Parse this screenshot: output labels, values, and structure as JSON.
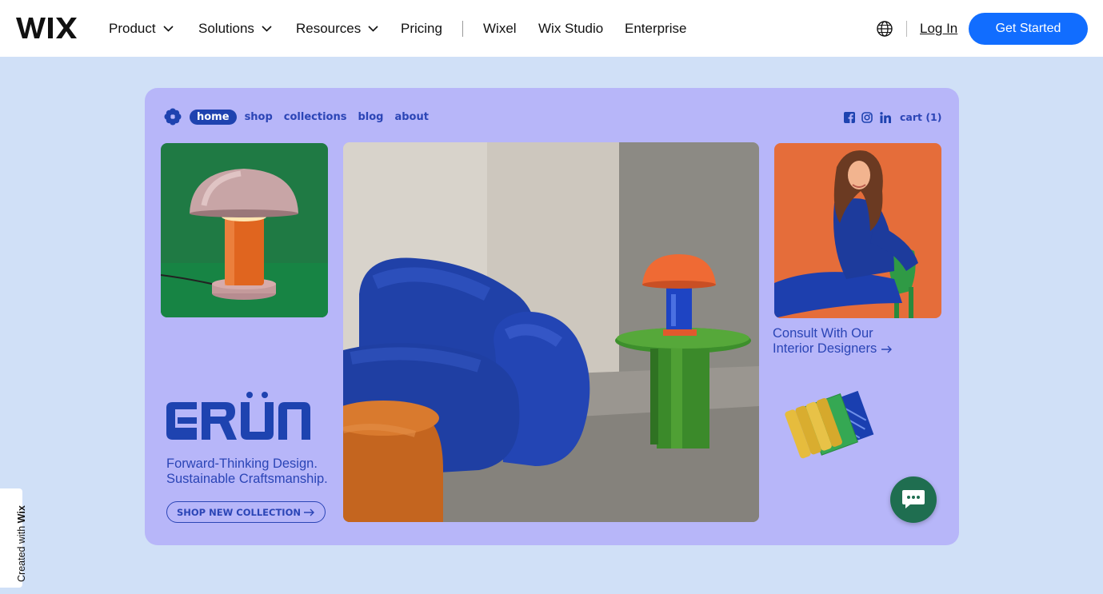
{
  "topnav": {
    "logo_text": "WIX",
    "items": [
      {
        "label": "Product",
        "dropdown": true
      },
      {
        "label": "Solutions",
        "dropdown": true
      },
      {
        "label": "Resources",
        "dropdown": true
      },
      {
        "label": "Pricing",
        "dropdown": false
      },
      {
        "label": "Wixel",
        "dropdown": false
      },
      {
        "label": "Wix Studio",
        "dropdown": false
      },
      {
        "label": "Enterprise",
        "dropdown": false
      }
    ],
    "language_icon": "globe-icon",
    "login_label": "Log In",
    "cta_label": "Get Started",
    "cta_color": "#116dff"
  },
  "showcase": {
    "background": "#b7b6f9",
    "accent": "#2b45b6",
    "site_nav": [
      "home",
      "shop",
      "collections",
      "blog",
      "about"
    ],
    "active_nav": "home",
    "social_icons": [
      "facebook-icon",
      "instagram-icon",
      "linkedin-icon"
    ],
    "cart_label": "cart (1)",
    "brand_name": "GRÜN",
    "tagline_line1": "Forward-Thinking Design.",
    "tagline_line2": "Sustainable Craftsmanship.",
    "shop_button_label": "SHOP NEW COLLECTION",
    "consult_line1": "Consult With Our",
    "consult_line2": "Interior Designers",
    "images": [
      "pink-mushroom-lamp-photo",
      "blue-sofa-living-room-photo",
      "woman-in-blue-sweater-photo",
      "product-samples-photo"
    ],
    "chat_color": "#1f6e50"
  },
  "badge": {
    "prefix": "Created with",
    "brand": "Wix"
  }
}
